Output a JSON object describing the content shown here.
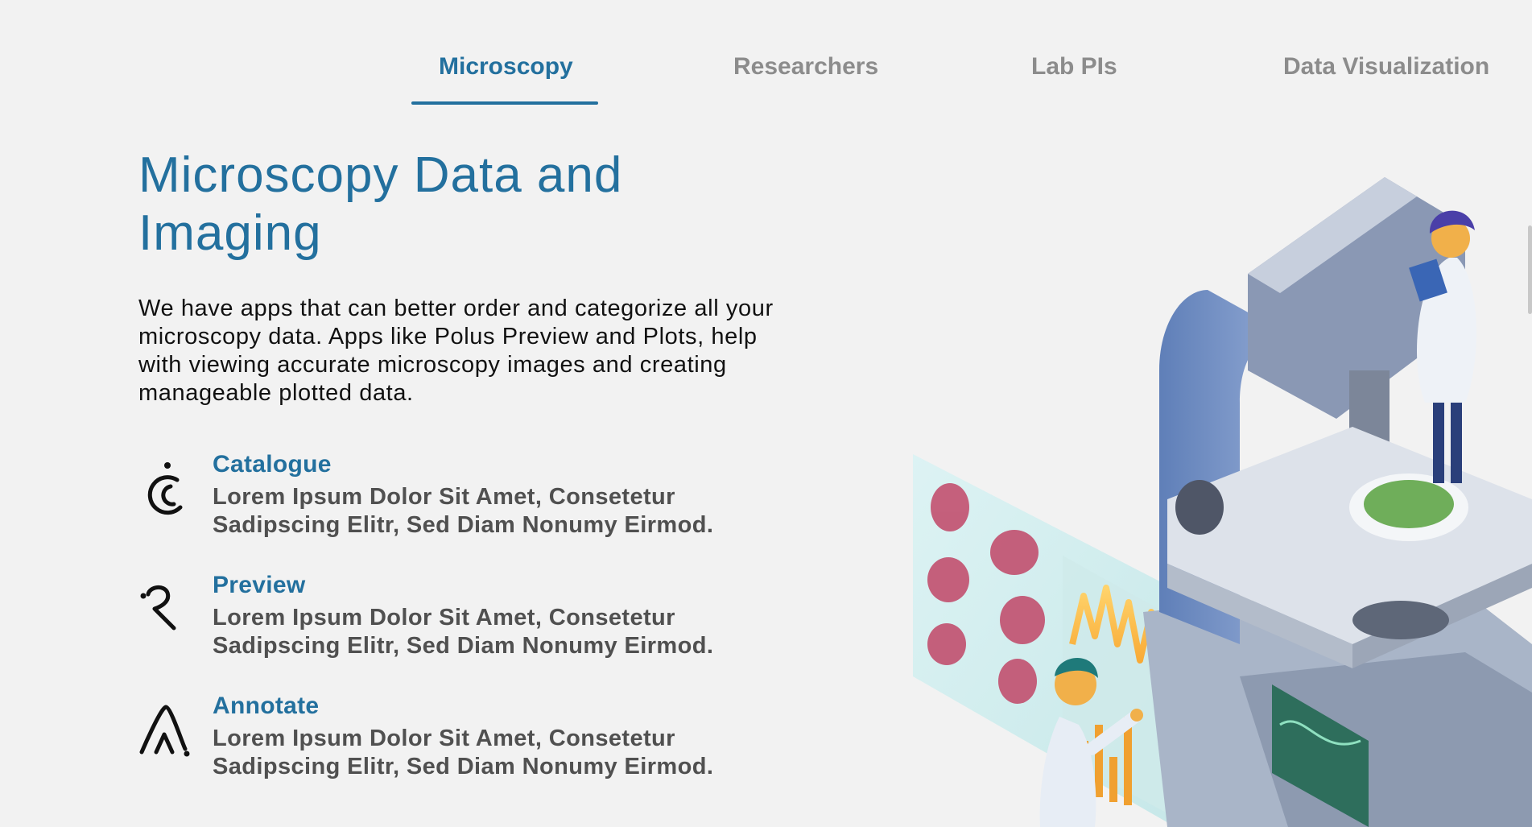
{
  "tabs": [
    {
      "label": "Microscopy",
      "active": true
    },
    {
      "label": "Researchers",
      "active": false
    },
    {
      "label": "Lab PIs",
      "active": false
    },
    {
      "label": "Data Visualization",
      "active": false
    }
  ],
  "main": {
    "title": "Microscopy Data and Imaging",
    "intro": "We have apps that can better order and categorize all your microscopy data. Apps like Polus Preview and Plots, help with viewing accurate microscopy images and creating manageable plotted data.",
    "features": [
      {
        "name": "Catalogue",
        "icon": "catalogue-icon",
        "description": "Lorem Ipsum Dolor Sit Amet, Consetetur Sadipscing Elitr, Sed Diam Nonumy Eirmod."
      },
      {
        "name": "Preview",
        "icon": "preview-icon",
        "description": "Lorem Ipsum Dolor Sit Amet, Consetetur Sadipscing Elitr, Sed Diam Nonumy Eirmod."
      },
      {
        "name": "Annotate",
        "icon": "annotate-icon",
        "description": "Lorem Ipsum Dolor Sit Amet, Consetetur Sadipscing Elitr, Sed Diam Nonumy Eirmod."
      }
    ]
  },
  "colors": {
    "accent": "#23709e",
    "inactive_tab": "#8c8c8c",
    "background": "#f2f2f2",
    "body_text": "#111111",
    "muted_text": "#505050"
  },
  "illustration": {
    "icon": "microscope-lab-illustration"
  }
}
